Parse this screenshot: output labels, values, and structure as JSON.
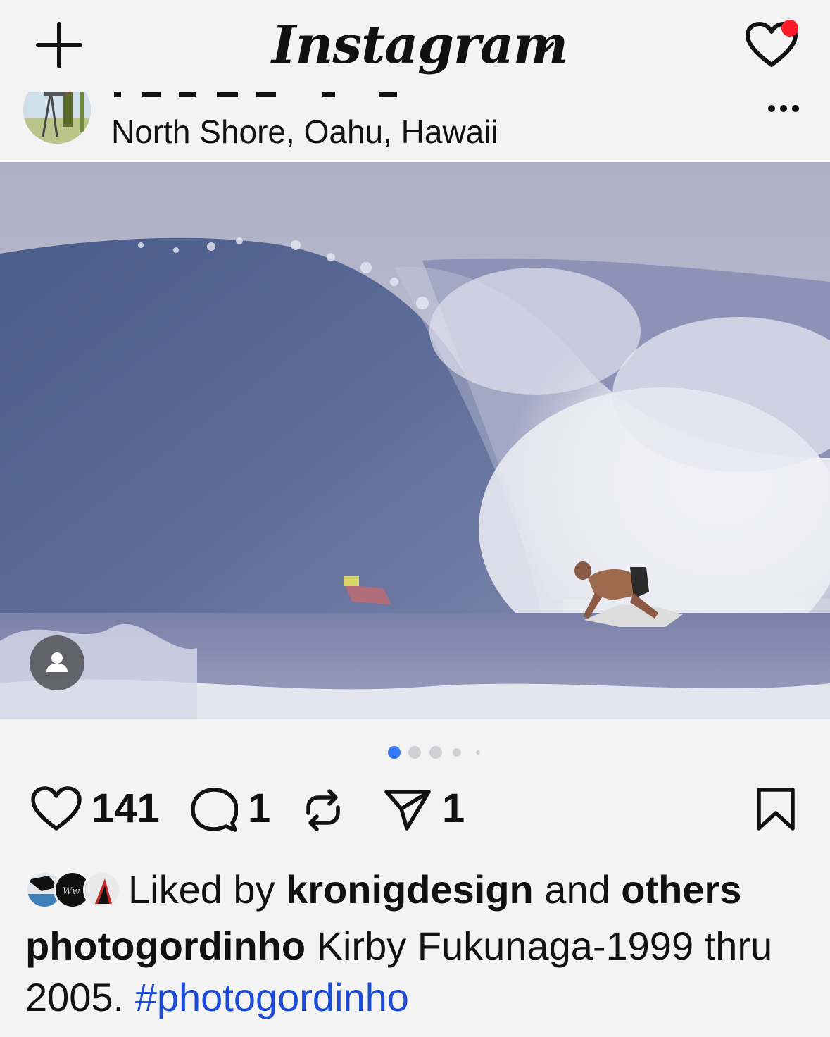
{
  "header": {
    "logo_text": "Instagram",
    "icons": {
      "create": "plus-icon",
      "feed_switch": "chevron-down-icon",
      "activity": "heart-icon"
    },
    "notification_dot_color": "#ff1a2b"
  },
  "post": {
    "location": "North Shore, Oahu, Hawaii",
    "carousel": {
      "total": 5,
      "active_index": 0,
      "active_color": "#3478f6"
    },
    "stats": {
      "likes": "141",
      "comments": "1",
      "shares": "1"
    },
    "liked_by": {
      "prefix": "Liked by ",
      "user": "kronigdesign",
      "middle": " and ",
      "suffix": "others"
    },
    "caption": {
      "username": "photogordinho",
      "text": " Kirby Fukunaga-1999 thru 2005. ",
      "hashtag": "#photogordinho"
    }
  }
}
